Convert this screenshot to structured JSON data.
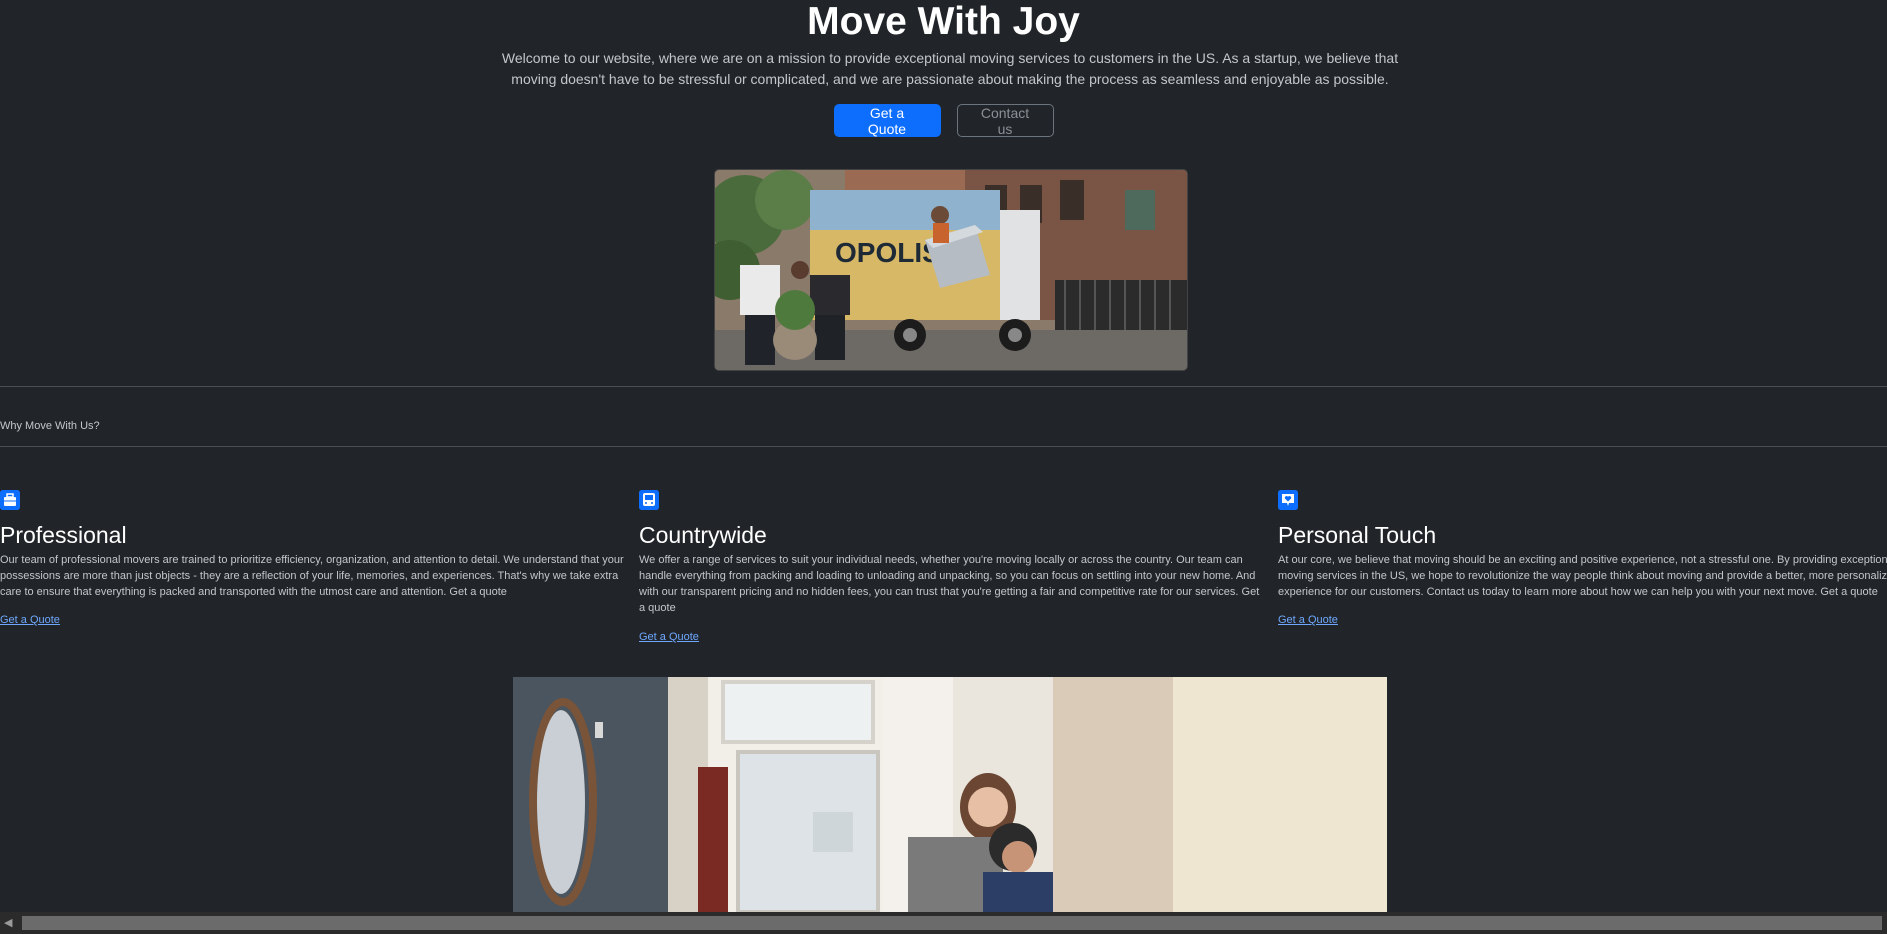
{
  "hero": {
    "title": "Move With Joy",
    "subtitle": "Welcome to our website, where we are on a mission to provide exceptional moving services to customers in the US. As a startup, we believe that moving doesn't have to be stressful or complicated, and we are passionate about making the process as seamless and enjoyable as possible.",
    "primary_button": "Get a Quote",
    "secondary_button": "Contact us"
  },
  "why": {
    "title": "Why Move With Us?"
  },
  "features": [
    {
      "icon": "briefcase-icon",
      "title": "Professional",
      "description": "Our team of professional movers are trained to prioritize efficiency, organization, and attention to detail. We understand that your possessions are more than just objects - they are a reflection of your life, memories, and experiences. That's why we take extra care to ensure that everything is packed and transported with the utmost care and attention. Get a quote",
      "link": "Get a Quote"
    },
    {
      "icon": "bus-icon",
      "title": "Countrywide",
      "description": "We offer a range of services to suit your individual needs, whether you're moving locally or across the country. Our team can handle everything from packing and loading to unloading and unpacking, so you can focus on settling into your new home. And with our transparent pricing and no hidden fees, you can trust that you're getting a fair and competitive rate for our services. Get a quote",
      "link": "Get a Quote"
    },
    {
      "icon": "chat-heart-icon",
      "title": "Personal Touch",
      "description": "At our core, we believe that moving should be an exciting and positive experience, not a stressful one. By providing exceptional moving services in the US, we hope to revolutionize the way people think about moving and provide a better, more personalized experience for our customers. Contact us today to learn more about how we can help you with your next move. Get a quote",
      "link": "Get a Quote"
    }
  ],
  "colors": {
    "background": "#212529",
    "primary": "#0d6efd",
    "link": "#6ea8fe"
  }
}
